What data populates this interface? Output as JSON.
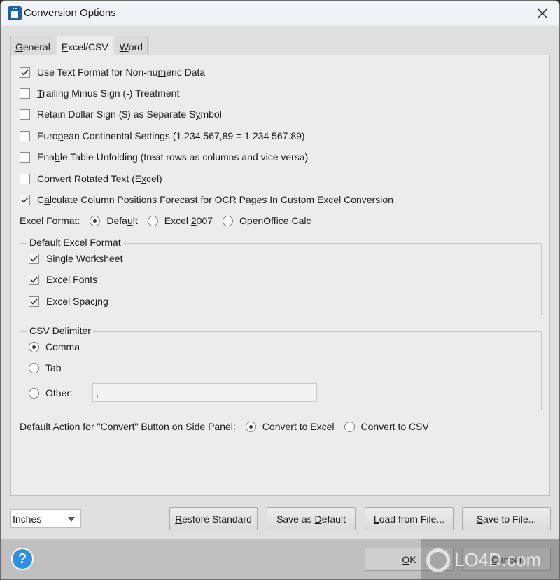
{
  "window": {
    "title": "Conversion Options"
  },
  "tabs": [
    {
      "label_u": "G",
      "label_rest": "eneral",
      "active": false
    },
    {
      "label_u": "E",
      "label_rest": "xcel/CSV",
      "active": true
    },
    {
      "label_u": "W",
      "label_rest": "ord",
      "active": false
    }
  ],
  "options": [
    {
      "pre": "Use Text Format for Non-nu",
      "u": "m",
      "post": "eric Data",
      "checked": true
    },
    {
      "pre": "",
      "u": "T",
      "post": "railing Minus Sign (-) Treatment",
      "checked": false
    },
    {
      "pre": "Retain Dollar Sign ($) as Separate S",
      "u": "y",
      "post": "mbol",
      "checked": false
    },
    {
      "pre": "Euro",
      "u": "p",
      "post": "ean Continental Settings (1.234.567,89 = 1 234 567.89)",
      "checked": false
    },
    {
      "pre": "Ena",
      "u": "b",
      "post": "le Table Unfolding (treat rows as columns and vice versa)",
      "checked": false
    },
    {
      "pre": "Convert Rotated Text (E",
      "u": "x",
      "post": "cel)",
      "checked": false
    },
    {
      "pre": "C",
      "u": "a",
      "post": "lculate Column Positions Forecast for OCR Pages In Custom Excel Conversion",
      "checked": true
    }
  ],
  "excel_format": {
    "label": "Excel Format:",
    "choices": [
      {
        "pre": "Defa",
        "u": "u",
        "post": "lt",
        "selected": true
      },
      {
        "pre": "Excel ",
        "u": "2",
        "post": "007",
        "selected": false
      },
      {
        "pre": "OpenOffice Calc",
        "u": "",
        "post": "",
        "selected": false
      }
    ]
  },
  "default_excel_format": {
    "title": "Default Excel Format",
    "items": [
      {
        "pre": "Single Works",
        "u": "h",
        "post": "eet",
        "checked": true
      },
      {
        "pre": "Excel ",
        "u": "F",
        "post": "onts",
        "checked": true
      },
      {
        "pre": "Excel Spac",
        "u": "i",
        "post": "ng",
        "checked": true
      }
    ]
  },
  "csv_delimiter": {
    "title": "CSV Delimiter",
    "choices": [
      {
        "label": "Comma",
        "selected": true
      },
      {
        "label": "Tab",
        "selected": false
      },
      {
        "label": "Other:",
        "selected": false
      }
    ],
    "other_value": ","
  },
  "default_action": {
    "label": "Default Action for \"Convert\" Button on Side Panel:",
    "choices": [
      {
        "pre": "Co",
        "u": "n",
        "post": "vert to Excel",
        "selected": true
      },
      {
        "pre": "Convert to CS",
        "u": "V",
        "post": "",
        "selected": false
      }
    ]
  },
  "units": {
    "selected": "Inches"
  },
  "buttons": {
    "restore": {
      "u": "R",
      "rest": "estore Standard"
    },
    "save_default": {
      "pre": "Save as ",
      "u": "D",
      "post": "efault"
    },
    "load_file": {
      "u": "L",
      "rest": "oad from File..."
    },
    "save_file": {
      "u": "S",
      "rest": "ave to File..."
    },
    "ok": {
      "u": "O",
      "rest": "K"
    },
    "cancel": {
      "pre": "",
      "u": "C",
      "post": "ancel"
    }
  },
  "help": {
    "glyph": "?"
  },
  "watermark": {
    "text": "LO4D.com"
  }
}
